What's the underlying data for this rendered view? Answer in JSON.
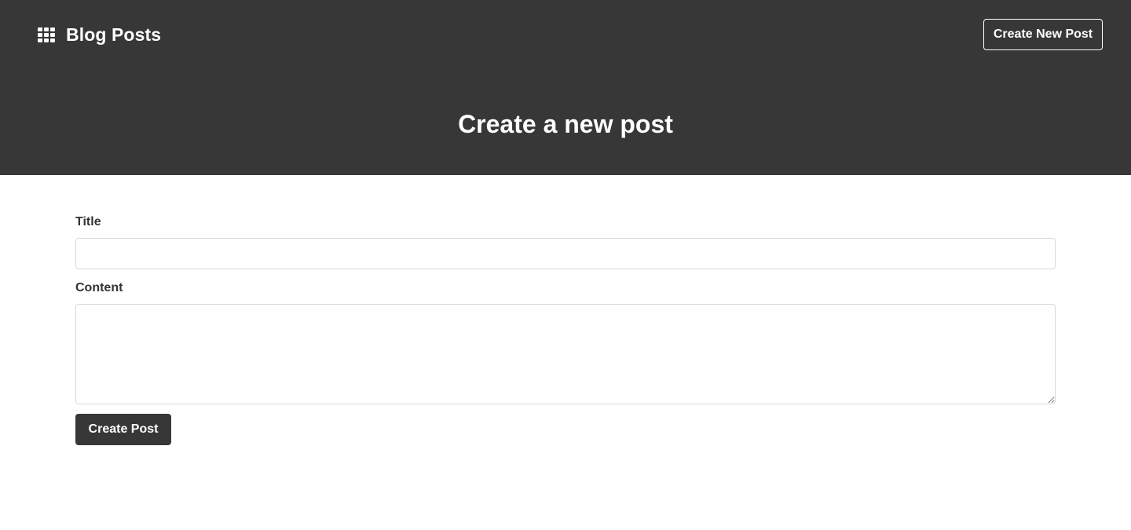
{
  "header": {
    "brand_icon": "grid-icon",
    "brand_title": "Blog Posts",
    "create_new_label": "Create New Post",
    "page_title": "Create a new post",
    "background_color": "#373737"
  },
  "form": {
    "title_label": "Title",
    "title_value": "",
    "title_placeholder": "",
    "content_label": "Content",
    "content_value": "",
    "content_placeholder": "",
    "submit_label": "Create Post"
  }
}
